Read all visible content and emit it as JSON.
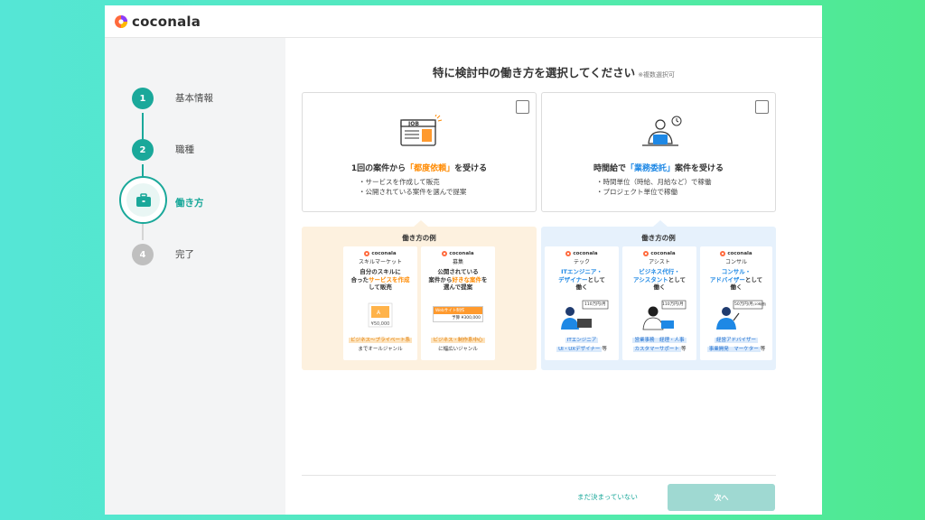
{
  "app": {
    "logo_text": "coconala"
  },
  "steps": [
    {
      "number": "1",
      "label": "基本情報"
    },
    {
      "number": "2",
      "label": "職種"
    },
    {
      "number": "",
      "label": "働き方"
    },
    {
      "number": "4",
      "label": "完了"
    }
  ],
  "main": {
    "heading": "特に検討中の働き方を選択してください",
    "heading_note": "※複数選択可",
    "cards": [
      {
        "title_pre": "1回の案件から",
        "title_hl": "「都度依頼」",
        "title_post": "を受ける",
        "bullets": [
          "・サービスを作成して販売",
          "・公開されている案件を選んで提案"
        ],
        "illus_label": "JOB"
      },
      {
        "title_pre": "時間給で",
        "title_hl": "「業務委託」",
        "title_post": "案件を受ける",
        "bullets": [
          "・時間単位（時給、月給など）で稼働",
          "・プロジェクト単位で稼働"
        ]
      }
    ],
    "panels": [
      {
        "title": "働き方の例",
        "items": [
          {
            "logo": "coconala",
            "brand": "スキルマーケット",
            "line1": "自分のスキルに",
            "line2_pre": "合った",
            "line2_hl": "サービスを作成",
            "line3": "して販売",
            "price": "¥50,000",
            "tag": "ビジネス〜プライベート系",
            "tag_sub": "までオールジャンル"
          },
          {
            "logo": "coconala",
            "brand": "募集",
            "line1": "公開されている",
            "line2_pre": "案件から",
            "line2_hl": "好きな案件",
            "line2_post": "を",
            "line3": "選んで提案",
            "job_label": "Webサイト制作",
            "price": "予算 ¥300,000",
            "tag": "ビジネス・制作系中心",
            "tag_sub": "に幅広いジャンル"
          }
        ]
      },
      {
        "title": "働き方の例",
        "items": [
          {
            "logo": "coconala",
            "brand": "テック",
            "line1": "ITエンジニア・",
            "line2": "デザイナーとして",
            "line3": "働く",
            "price": "110万円/月",
            "tag": "ITエンジニア",
            "tag_sub": "UI・UXデザイナー",
            "tag_suffix": "等"
          },
          {
            "logo": "coconala",
            "brand": "アシスト",
            "line1": "ビジネス代行・",
            "line2": "アシスタントとして",
            "line3": "働く",
            "price": "110万円/月",
            "tag": "営業事務　経理・人事",
            "tag_sub": "カスタマーサポート",
            "tag_suffix": "等"
          },
          {
            "logo": "coconala",
            "brand": "コンサル",
            "line1": "コンサル・",
            "line2": "アドバイザーとして",
            "line3": "働く",
            "price": "50万円/月",
            "price_note": "(10時間)",
            "tag": "経営アドバイザー",
            "tag_sub": "事業開発　マーケター",
            "tag_suffix": "等"
          }
        ]
      }
    ]
  },
  "footer": {
    "undecided_label": "まだ決まっていない",
    "next_label": "次へ"
  },
  "colors": {
    "teal": "#1aa89a",
    "orange": "#ff8a00",
    "blue": "#1e88e5"
  }
}
